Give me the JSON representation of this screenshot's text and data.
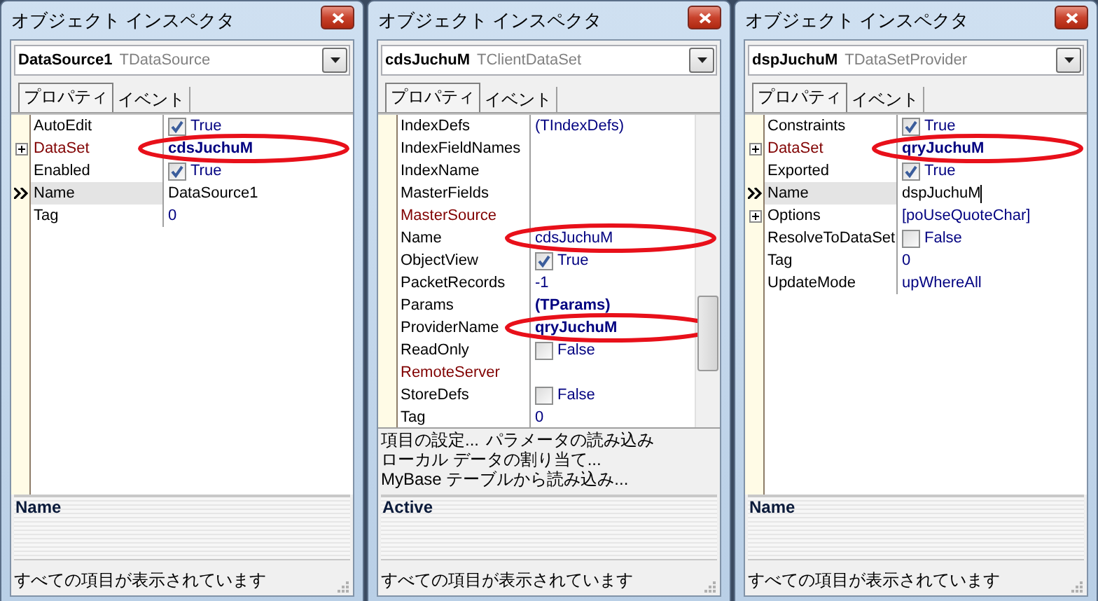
{
  "windows": [
    {
      "title": "オブジェクト インスペクタ",
      "object": {
        "name": "DataSource1",
        "type": "TDataSource"
      },
      "scrollable": false,
      "tabs": [
        {
          "label": "プロパティ",
          "selected": true
        },
        {
          "label": "イベント",
          "selected": false
        }
      ],
      "properties": [
        {
          "name": "AutoEdit",
          "kind": "check",
          "checked": true,
          "value": "True",
          "expandable": false,
          "reference": false,
          "bold": false,
          "selected": false,
          "circled": false
        },
        {
          "name": "DataSet",
          "kind": "text",
          "value": "cdsJuchuM",
          "expandable": true,
          "reference": true,
          "bold": true,
          "selected": false,
          "circled": true
        },
        {
          "name": "Enabled",
          "kind": "check",
          "checked": true,
          "value": "True",
          "expandable": false,
          "reference": false,
          "bold": false,
          "selected": false,
          "circled": false
        },
        {
          "name": "Name",
          "kind": "text",
          "value": "DataSource1",
          "expandable": false,
          "reference": false,
          "bold": false,
          "selected": true,
          "editing": false,
          "circled": false
        },
        {
          "name": "Tag",
          "kind": "text",
          "value": "0",
          "expandable": false,
          "reference": false,
          "bold": false,
          "selected": false,
          "circled": false
        }
      ],
      "description": "Name",
      "status": "すべての項目が表示されています"
    },
    {
      "title": "オブジェクト インスペクタ",
      "object": {
        "name": "cdsJuchuM",
        "type": "TClientDataSet"
      },
      "scrollable": true,
      "tabs": [
        {
          "label": "プロパティ",
          "selected": true
        },
        {
          "label": "イベント",
          "selected": false
        }
      ],
      "properties": [
        {
          "name": "IndexDefs",
          "kind": "text",
          "value": "(TIndexDefs)",
          "expandable": false,
          "reference": false,
          "bold": false,
          "selected": false,
          "circled": false
        },
        {
          "name": "IndexFieldNames",
          "kind": "text",
          "expandable": false,
          "reference": false,
          "selected": false,
          "circled": false
        },
        {
          "name": "IndexName",
          "kind": "text",
          "expandable": false,
          "reference": false,
          "selected": false,
          "circled": false
        },
        {
          "name": "MasterFields",
          "kind": "text",
          "expandable": false,
          "reference": false,
          "selected": false,
          "circled": false
        },
        {
          "name": "MasterSource",
          "kind": "text",
          "expandable": false,
          "reference": true,
          "selected": false,
          "circled": false
        },
        {
          "name": "Name",
          "kind": "text",
          "value": "cdsJuchuM",
          "expandable": false,
          "reference": false,
          "bold": false,
          "selected": false,
          "circled": true
        },
        {
          "name": "ObjectView",
          "kind": "check",
          "checked": true,
          "value": "True",
          "expandable": false,
          "reference": false,
          "bold": false,
          "selected": false,
          "circled": false
        },
        {
          "name": "PacketRecords",
          "kind": "text",
          "value": "-1",
          "expandable": false,
          "reference": false,
          "bold": false,
          "selected": false,
          "circled": false
        },
        {
          "name": "Params",
          "kind": "text",
          "value": "(TParams)",
          "expandable": false,
          "reference": false,
          "bold": true,
          "selected": false,
          "circled": false
        },
        {
          "name": "ProviderName",
          "kind": "text",
          "value": "qryJuchuM",
          "expandable": false,
          "reference": false,
          "bold": true,
          "selected": false,
          "circled": true
        },
        {
          "name": "ReadOnly",
          "kind": "check",
          "checked": false,
          "value": "False",
          "expandable": false,
          "reference": false,
          "bold": false,
          "selected": false,
          "circled": false
        },
        {
          "name": "RemoteServer",
          "kind": "text",
          "expandable": false,
          "reference": true,
          "selected": false,
          "circled": false
        },
        {
          "name": "StoreDefs",
          "kind": "check",
          "checked": false,
          "value": "False",
          "expandable": false,
          "reference": false,
          "bold": false,
          "selected": false,
          "circled": false
        },
        {
          "name": "Tag",
          "kind": "text",
          "value": "0",
          "expandable": false,
          "reference": false,
          "bold": false,
          "selected": false,
          "circled": false
        }
      ],
      "verbs": [
        [
          "項目の設定...",
          "パラメータの読み込み"
        ],
        [
          "ローカル データの割り当て..."
        ],
        [
          "MyBase テーブルから読み込み..."
        ]
      ],
      "description": "Active",
      "status": "すべての項目が表示されています"
    },
    {
      "title": "オブジェクト インスペクタ",
      "object": {
        "name": "dspJuchuM",
        "type": "TDataSetProvider"
      },
      "scrollable": false,
      "tabs": [
        {
          "label": "プロパティ",
          "selected": true
        },
        {
          "label": "イベント",
          "selected": false
        }
      ],
      "properties": [
        {
          "name": "Constraints",
          "kind": "check",
          "checked": true,
          "value": "True",
          "expandable": false,
          "reference": false,
          "bold": false,
          "selected": false,
          "circled": false
        },
        {
          "name": "DataSet",
          "kind": "text",
          "value": "qryJuchuM",
          "expandable": true,
          "reference": true,
          "bold": true,
          "selected": false,
          "circled": true
        },
        {
          "name": "Exported",
          "kind": "check",
          "checked": true,
          "value": "True",
          "expandable": false,
          "reference": false,
          "bold": false,
          "selected": false,
          "circled": false
        },
        {
          "name": "Name",
          "kind": "text",
          "value": "dspJuchuM",
          "expandable": false,
          "reference": false,
          "bold": false,
          "selected": true,
          "editing": true,
          "circled": false
        },
        {
          "name": "Options",
          "kind": "text",
          "value": "[poUseQuoteChar]",
          "expandable": true,
          "reference": false,
          "bold": false,
          "selected": false,
          "circled": false
        },
        {
          "name": "ResolveToDataSet",
          "kind": "check",
          "checked": false,
          "value": "False",
          "expandable": false,
          "reference": false,
          "bold": false,
          "selected": false,
          "circled": false
        },
        {
          "name": "Tag",
          "kind": "text",
          "value": "0",
          "expandable": false,
          "reference": false,
          "bold": false,
          "selected": false,
          "circled": false
        },
        {
          "name": "UpdateMode",
          "kind": "text",
          "value": "upWhereAll",
          "expandable": false,
          "reference": false,
          "bold": false,
          "selected": false,
          "circled": false
        }
      ],
      "description": "Name",
      "status": "すべての項目が表示されています"
    }
  ]
}
